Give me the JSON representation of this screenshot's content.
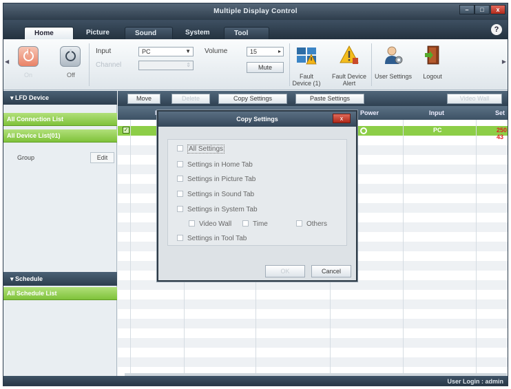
{
  "window": {
    "title": "Multiple Display Control"
  },
  "tabs": [
    "Home",
    "Picture",
    "Sound",
    "System",
    "Tool"
  ],
  "help": "?",
  "ribbon": {
    "power_on_label": "On",
    "power_off_label": "Off",
    "input_label": "Input",
    "input_value": "PC",
    "channel_label": "Channel",
    "volume_label": "Volume",
    "volume_value": "15",
    "mute_label": "Mute",
    "fault_device_label": "Fault Device (1)",
    "fault_alert_label": "Fault Device Alert",
    "user_settings_label": "User Settings",
    "logout_label": "Logout"
  },
  "sidebar": {
    "lfd_header": "LFD Device",
    "all_connection": "All Connection List",
    "all_device": "All Device List(01)",
    "group_label": "Group",
    "edit_label": "Edit",
    "schedule_header": "Schedule",
    "all_schedule": "All Schedule List"
  },
  "toolbar": {
    "move": "Move",
    "delete": "Delete",
    "copy_settings": "Copy Settings",
    "paste_settings": "Paste Settings",
    "video_wall": "Video Wall"
  },
  "grid": {
    "headers": [
      "ID",
      "Power",
      "Input",
      "Set"
    ],
    "row1": {
      "input": "PC",
      "set": "250 43"
    }
  },
  "dialog": {
    "title": "Copy Settings",
    "close": "x",
    "all_settings": "All Settings",
    "home_tab": "Settings in Home Tab",
    "picture_tab": "Settings in Picture Tab",
    "sound_tab": "Settings in Sound Tab",
    "system_tab": "Settings in System Tab",
    "video_wall": "Video Wall",
    "time": "Time",
    "others": "Others",
    "tool_tab": "Settings in Tool Tab",
    "ok": "OK",
    "cancel": "Cancel"
  },
  "status": {
    "login": "User Login : admin"
  },
  "colors": {
    "accent_green": "#8dce47",
    "header_dark": "#2d3e4e",
    "close_red": "#b22a1b"
  }
}
